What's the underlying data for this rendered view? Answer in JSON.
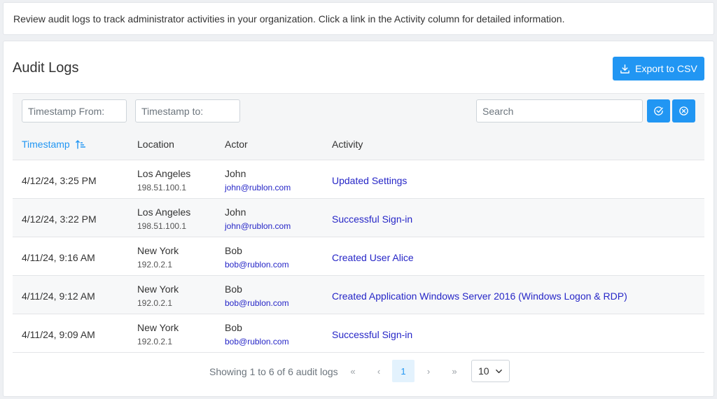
{
  "info_text": "Review audit logs to track administrator activities in your organization. Click a link in the Activity column for detailed information.",
  "title": "Audit Logs",
  "export_label": "Export to CSV",
  "filters": {
    "from_placeholder": "Timestamp From:",
    "to_placeholder": "Timestamp to:",
    "search_placeholder": "Search"
  },
  "columns": {
    "timestamp": "Timestamp",
    "location": "Location",
    "actor": "Actor",
    "activity": "Activity"
  },
  "rows": [
    {
      "timestamp": "4/12/24, 3:25 PM",
      "city": "Los Angeles",
      "ip": "198.51.100.1",
      "name": "John",
      "email": "john@rublon.com",
      "activity": "Updated Settings"
    },
    {
      "timestamp": "4/12/24, 3:22 PM",
      "city": "Los Angeles",
      "ip": "198.51.100.1",
      "name": "John",
      "email": "john@rublon.com",
      "activity": "Successful Sign-in"
    },
    {
      "timestamp": "4/11/24, 9:16 AM",
      "city": "New York",
      "ip": "192.0.2.1",
      "name": "Bob",
      "email": "bob@rublon.com",
      "activity": "Created User Alice"
    },
    {
      "timestamp": "4/11/24, 9:12 AM",
      "city": "New York",
      "ip": "192.0.2.1",
      "name": "Bob",
      "email": "bob@rublon.com",
      "activity": "Created Application Windows Server 2016 (Windows Logon & RDP)"
    },
    {
      "timestamp": "4/11/24, 9:09 AM",
      "city": "New York",
      "ip": "192.0.2.1",
      "name": "Bob",
      "email": "bob@rublon.com",
      "activity": "Successful Sign-in"
    }
  ],
  "pagination": {
    "showing": "Showing 1 to 6 of 6 audit logs",
    "first": "«",
    "prev": "‹",
    "current": "1",
    "next": "›",
    "last": "»",
    "per_page": "10"
  },
  "colors": {
    "accent": "#2196f3",
    "link": "#2626c7"
  },
  "icons": {
    "export": "download-icon",
    "sort": "sort-ascending-icon",
    "apply": "check-circle-icon",
    "clear": "x-circle-icon",
    "per_page": "chevron-down-icon"
  }
}
